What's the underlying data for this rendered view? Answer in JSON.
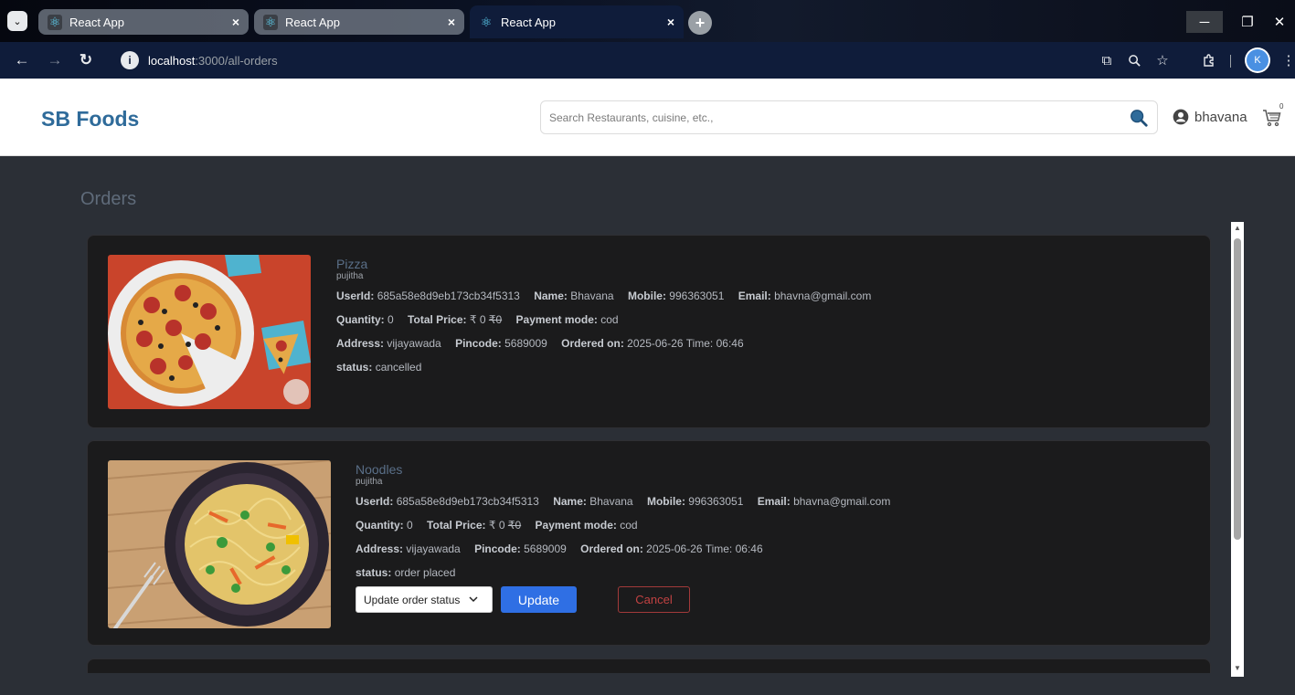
{
  "browser": {
    "tabs": [
      {
        "title": "React App",
        "state": "inactive"
      },
      {
        "title": "React App",
        "state": "inactive"
      },
      {
        "title": "React App",
        "state": "active"
      }
    ],
    "tab_close_glyph": "×",
    "new_tab_glyph": "+",
    "url_host": "localhost",
    "url_path": ":3000/all-orders",
    "profile_initial": "K"
  },
  "header": {
    "brand": "SB Foods",
    "search_placeholder": "Search Restaurants, cuisine, etc.,",
    "username": "bhavana",
    "cart_count": "0"
  },
  "page": {
    "title": "Orders"
  },
  "labels": {
    "user_id": "UserId:",
    "name": "Name:",
    "mobile": "Mobile:",
    "email": "Email:",
    "quantity": "Quantity:",
    "total_price": "Total Price:",
    "payment_mode": "Payment mode:",
    "address": "Address:",
    "pincode": "Pincode:",
    "ordered_on": "Ordered on:",
    "time": "Time:",
    "status": "status:"
  },
  "orders": [
    {
      "food_name": "Pizza",
      "restaurant": "pujitha",
      "user_id": "685a58e8d9eb173cb34f5313",
      "name": "Bhavana",
      "mobile": "996363051",
      "email": "bhavna@gmail.com",
      "quantity": "0",
      "price": "₹ 0",
      "original_price": "₹0",
      "payment_mode": "cod",
      "address": "vijayawada",
      "pincode": "5689009",
      "ordered_on": "2025-06-26",
      "time": "06:46",
      "status": "cancelled"
    },
    {
      "food_name": "Noodles",
      "restaurant": "pujitha",
      "user_id": "685a58e8d9eb173cb34f5313",
      "name": "Bhavana",
      "mobile": "996363051",
      "email": "bhavna@gmail.com",
      "quantity": "0",
      "price": "₹ 0",
      "original_price": "₹0",
      "payment_mode": "cod",
      "address": "vijayawada",
      "pincode": "5689009",
      "ordered_on": "2025-06-26",
      "time": "06:46",
      "status": "order placed",
      "controls": {
        "select_value": "Update order status",
        "update_label": "Update",
        "cancel_label": "Cancel"
      }
    }
  ],
  "colors": {
    "brand": "#2f6b9a",
    "page_bg": "#2b2f36",
    "card_bg": "#1b1b1c",
    "update_button": "#2f6fe4",
    "cancel_button": "#c14242"
  }
}
